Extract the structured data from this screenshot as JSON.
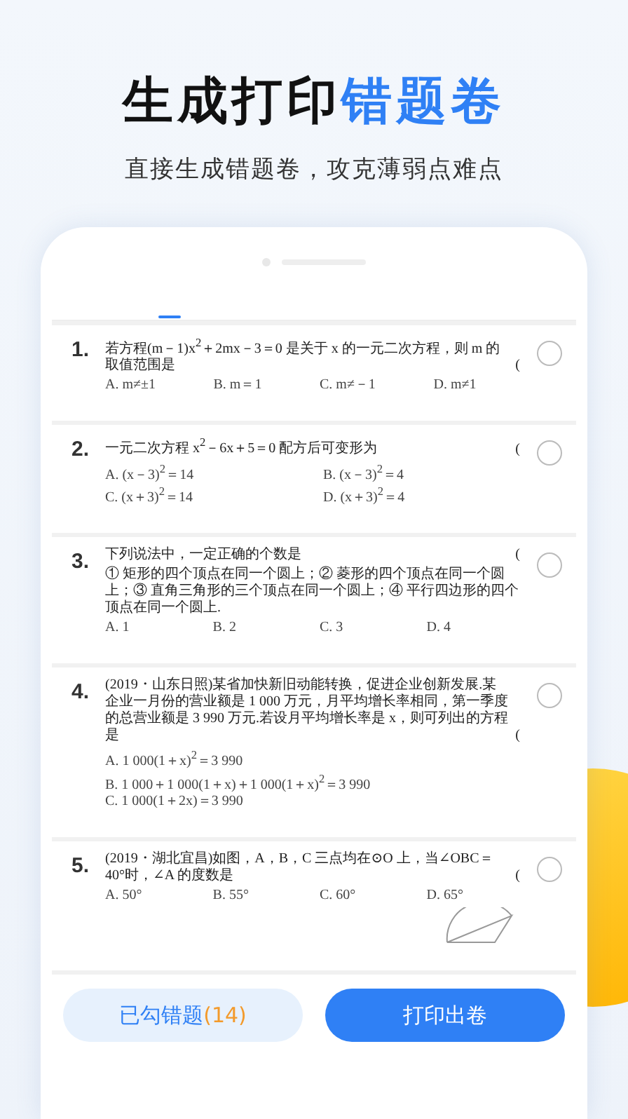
{
  "headline": {
    "plain": "生成打印",
    "accent": "错题卷"
  },
  "subtitle": "直接生成错题卷，攻克薄弱点难点",
  "questions": [
    {
      "number": "1.",
      "stem": "若方程(m－1)x$^{2}$＋2mx－3＝0 是关于 x 的一元二次方程，则 m 的取值范围是",
      "bracket": "(",
      "options": [
        "A. m≠±1",
        "B. m＝1",
        "C. m≠－1",
        "D. m≠1"
      ],
      "kind": "row",
      "selected": false
    },
    {
      "number": "2.",
      "stem": "一元二次方程 x$^{2}$－6x＋5＝0 配方后可变形为",
      "bracket": "(",
      "options": [
        "A. (x－3)$^{2}$＝14",
        "B. (x－3)$^{2}$＝4",
        "C. (x＋3)$^{2}$＝14",
        "D. (x＋3)$^{2}$＝4"
      ],
      "kind": "grid",
      "selected": false
    },
    {
      "number": "3.",
      "stem": "下列说法中，一定正确的个数是",
      "bracket": "(",
      "statement": "① 矩形的四个顶点在同一个圆上；② 菱形的四个顶点在同一个圆上；③ 直角三角形的三个顶点在同一个圆上；④ 平行四边形的四个顶点在同一个圆上.",
      "options": [
        "A. 1",
        "B. 2",
        "C. 3",
        "D. 4"
      ],
      "kind": "row",
      "selected": false
    },
    {
      "number": "4.",
      "stem": "(2019・山东日照)某省加快新旧动能转换，促进企业创新发展.某企业一月份的营业额是 1 000 万元，月平均增长率相同，第一季度的总营业额是 3 990 万元.若设月平均增长率是 x，则可列出的方程是",
      "bracket": "(",
      "options": [
        "A. 1 000(1＋x)$^{2}$＝3 990",
        "B. 1 000＋1 000(1＋x)＋1 000(1＋x)$^{2}$＝3 990",
        "C. 1 000(1＋2x)＝3 990"
      ],
      "kind": "stack",
      "selected": false
    },
    {
      "number": "5.",
      "stem": "(2019・湖北宜昌)如图，A，B，C 三点均在⊙O 上，当∠OBC＝40°时，∠A 的度数是",
      "bracket": "(",
      "options": [
        "A. 50°",
        "B. 55°",
        "C. 60°",
        "D. 65°"
      ],
      "kind": "row",
      "figure": true,
      "selected": false
    }
  ],
  "checked_button": {
    "label": "已勾错题",
    "count": "(14)"
  },
  "print_button": "打印出卷"
}
